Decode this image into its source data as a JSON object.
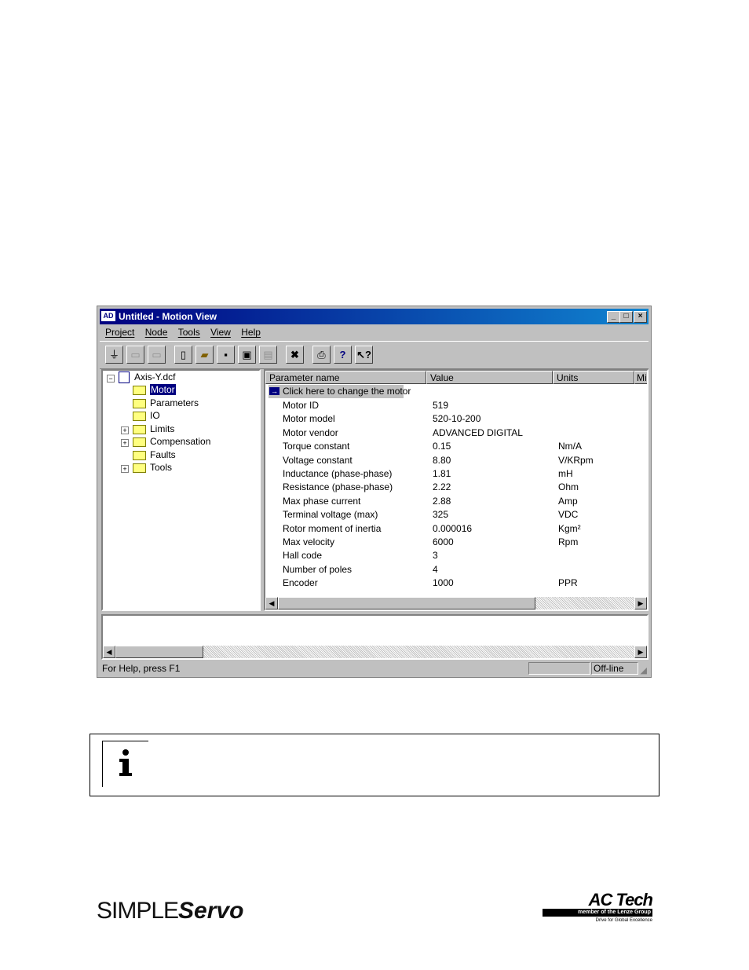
{
  "window": {
    "title": "Untitled - Motion View",
    "logo": "AD",
    "controls": [
      "minimize-icon",
      "maximize-icon",
      "close-icon"
    ]
  },
  "menu": [
    "Project",
    "Node",
    "Tools",
    "View",
    "Help"
  ],
  "toolbar_icons": [
    "connect-icon",
    "disconnect-icon",
    "network-icon",
    "new-icon",
    "open-icon",
    "save-icon",
    "save-all-icon",
    "copy-icon",
    "delete-icon",
    "print-icon",
    "help-icon",
    "context-help-icon"
  ],
  "tree": {
    "root": "Axis-Y.dcf",
    "items": [
      {
        "label": "Motor",
        "selected": true,
        "expandable": false
      },
      {
        "label": "Parameters",
        "expandable": false
      },
      {
        "label": "IO",
        "expandable": false
      },
      {
        "label": "Limits",
        "expandable": true
      },
      {
        "label": "Compensation",
        "expandable": true
      },
      {
        "label": "Faults",
        "expandable": false
      },
      {
        "label": "Tools",
        "expandable": true
      }
    ]
  },
  "grid": {
    "headers": [
      "Parameter name",
      "Value",
      "Units",
      "Mi"
    ],
    "change_motor": "Click here to change the motor",
    "rows": [
      {
        "name": "Motor ID",
        "value": "519",
        "units": ""
      },
      {
        "name": "Motor model",
        "value": "520-10-200",
        "units": ""
      },
      {
        "name": "Motor vendor",
        "value": "ADVANCED DIGITAL",
        "units": ""
      },
      {
        "name": "Torque constant",
        "value": "0.15",
        "units": "Nm/A"
      },
      {
        "name": "Voltage constant",
        "value": "8.80",
        "units": "V/KRpm"
      },
      {
        "name": "Inductance (phase-phase)",
        "value": "1.81",
        "units": "mH"
      },
      {
        "name": "Resistance (phase-phase)",
        "value": "2.22",
        "units": "Ohm"
      },
      {
        "name": "Max phase current",
        "value": "2.88",
        "units": "Amp"
      },
      {
        "name": "Terminal voltage (max)",
        "value": "325",
        "units": "VDC"
      },
      {
        "name": "Rotor moment of inertia",
        "value": "0.000016",
        "units": "Kgm²"
      },
      {
        "name": "Max velocity",
        "value": "6000",
        "units": "Rpm"
      },
      {
        "name": "Hall code",
        "value": "3",
        "units": ""
      },
      {
        "name": "Number of poles",
        "value": "4",
        "units": ""
      },
      {
        "name": "Encoder",
        "value": "1000",
        "units": "PPR"
      }
    ]
  },
  "status": {
    "help": "For Help, press F1",
    "state": "Off-line"
  },
  "info": {
    "icon": "info-icon"
  },
  "footer": {
    "left_brand_a": "SIMPLE",
    "left_brand_b": "Servo",
    "right_brand": "AC Tech",
    "right_sub": "member of the Lenze Group",
    "right_tag": "Drive for Global Excellence"
  }
}
